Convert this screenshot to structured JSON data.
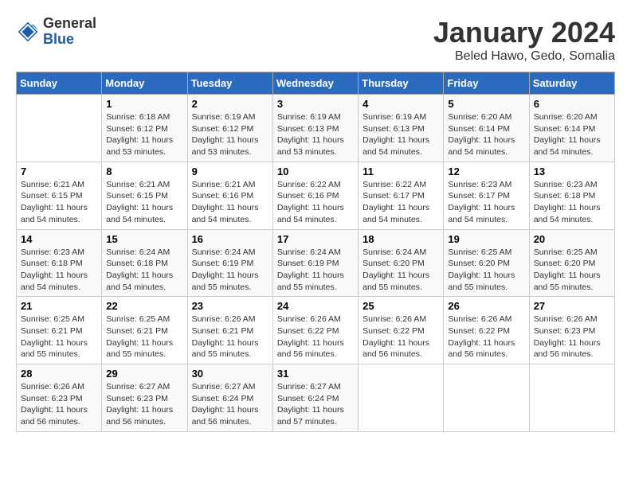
{
  "header": {
    "logo_general": "General",
    "logo_blue": "Blue",
    "month": "January 2024",
    "location": "Beled Hawo, Gedo, Somalia"
  },
  "weekdays": [
    "Sunday",
    "Monday",
    "Tuesday",
    "Wednesday",
    "Thursday",
    "Friday",
    "Saturday"
  ],
  "weeks": [
    [
      {
        "num": "",
        "info": ""
      },
      {
        "num": "1",
        "info": "Sunrise: 6:18 AM\nSunset: 6:12 PM\nDaylight: 11 hours\nand 53 minutes."
      },
      {
        "num": "2",
        "info": "Sunrise: 6:19 AM\nSunset: 6:12 PM\nDaylight: 11 hours\nand 53 minutes."
      },
      {
        "num": "3",
        "info": "Sunrise: 6:19 AM\nSunset: 6:13 PM\nDaylight: 11 hours\nand 53 minutes."
      },
      {
        "num": "4",
        "info": "Sunrise: 6:19 AM\nSunset: 6:13 PM\nDaylight: 11 hours\nand 54 minutes."
      },
      {
        "num": "5",
        "info": "Sunrise: 6:20 AM\nSunset: 6:14 PM\nDaylight: 11 hours\nand 54 minutes."
      },
      {
        "num": "6",
        "info": "Sunrise: 6:20 AM\nSunset: 6:14 PM\nDaylight: 11 hours\nand 54 minutes."
      }
    ],
    [
      {
        "num": "7",
        "info": "Sunrise: 6:21 AM\nSunset: 6:15 PM\nDaylight: 11 hours\nand 54 minutes."
      },
      {
        "num": "8",
        "info": "Sunrise: 6:21 AM\nSunset: 6:15 PM\nDaylight: 11 hours\nand 54 minutes."
      },
      {
        "num": "9",
        "info": "Sunrise: 6:21 AM\nSunset: 6:16 PM\nDaylight: 11 hours\nand 54 minutes."
      },
      {
        "num": "10",
        "info": "Sunrise: 6:22 AM\nSunset: 6:16 PM\nDaylight: 11 hours\nand 54 minutes."
      },
      {
        "num": "11",
        "info": "Sunrise: 6:22 AM\nSunset: 6:17 PM\nDaylight: 11 hours\nand 54 minutes."
      },
      {
        "num": "12",
        "info": "Sunrise: 6:23 AM\nSunset: 6:17 PM\nDaylight: 11 hours\nand 54 minutes."
      },
      {
        "num": "13",
        "info": "Sunrise: 6:23 AM\nSunset: 6:18 PM\nDaylight: 11 hours\nand 54 minutes."
      }
    ],
    [
      {
        "num": "14",
        "info": "Sunrise: 6:23 AM\nSunset: 6:18 PM\nDaylight: 11 hours\nand 54 minutes."
      },
      {
        "num": "15",
        "info": "Sunrise: 6:24 AM\nSunset: 6:18 PM\nDaylight: 11 hours\nand 54 minutes."
      },
      {
        "num": "16",
        "info": "Sunrise: 6:24 AM\nSunset: 6:19 PM\nDaylight: 11 hours\nand 55 minutes."
      },
      {
        "num": "17",
        "info": "Sunrise: 6:24 AM\nSunset: 6:19 PM\nDaylight: 11 hours\nand 55 minutes."
      },
      {
        "num": "18",
        "info": "Sunrise: 6:24 AM\nSunset: 6:20 PM\nDaylight: 11 hours\nand 55 minutes."
      },
      {
        "num": "19",
        "info": "Sunrise: 6:25 AM\nSunset: 6:20 PM\nDaylight: 11 hours\nand 55 minutes."
      },
      {
        "num": "20",
        "info": "Sunrise: 6:25 AM\nSunset: 6:20 PM\nDaylight: 11 hours\nand 55 minutes."
      }
    ],
    [
      {
        "num": "21",
        "info": "Sunrise: 6:25 AM\nSunset: 6:21 PM\nDaylight: 11 hours\nand 55 minutes."
      },
      {
        "num": "22",
        "info": "Sunrise: 6:25 AM\nSunset: 6:21 PM\nDaylight: 11 hours\nand 55 minutes."
      },
      {
        "num": "23",
        "info": "Sunrise: 6:26 AM\nSunset: 6:21 PM\nDaylight: 11 hours\nand 55 minutes."
      },
      {
        "num": "24",
        "info": "Sunrise: 6:26 AM\nSunset: 6:22 PM\nDaylight: 11 hours\nand 56 minutes."
      },
      {
        "num": "25",
        "info": "Sunrise: 6:26 AM\nSunset: 6:22 PM\nDaylight: 11 hours\nand 56 minutes."
      },
      {
        "num": "26",
        "info": "Sunrise: 6:26 AM\nSunset: 6:22 PM\nDaylight: 11 hours\nand 56 minutes."
      },
      {
        "num": "27",
        "info": "Sunrise: 6:26 AM\nSunset: 6:23 PM\nDaylight: 11 hours\nand 56 minutes."
      }
    ],
    [
      {
        "num": "28",
        "info": "Sunrise: 6:26 AM\nSunset: 6:23 PM\nDaylight: 11 hours\nand 56 minutes."
      },
      {
        "num": "29",
        "info": "Sunrise: 6:27 AM\nSunset: 6:23 PM\nDaylight: 11 hours\nand 56 minutes."
      },
      {
        "num": "30",
        "info": "Sunrise: 6:27 AM\nSunset: 6:24 PM\nDaylight: 11 hours\nand 56 minutes."
      },
      {
        "num": "31",
        "info": "Sunrise: 6:27 AM\nSunset: 6:24 PM\nDaylight: 11 hours\nand 57 minutes."
      },
      {
        "num": "",
        "info": ""
      },
      {
        "num": "",
        "info": ""
      },
      {
        "num": "",
        "info": ""
      }
    ]
  ]
}
